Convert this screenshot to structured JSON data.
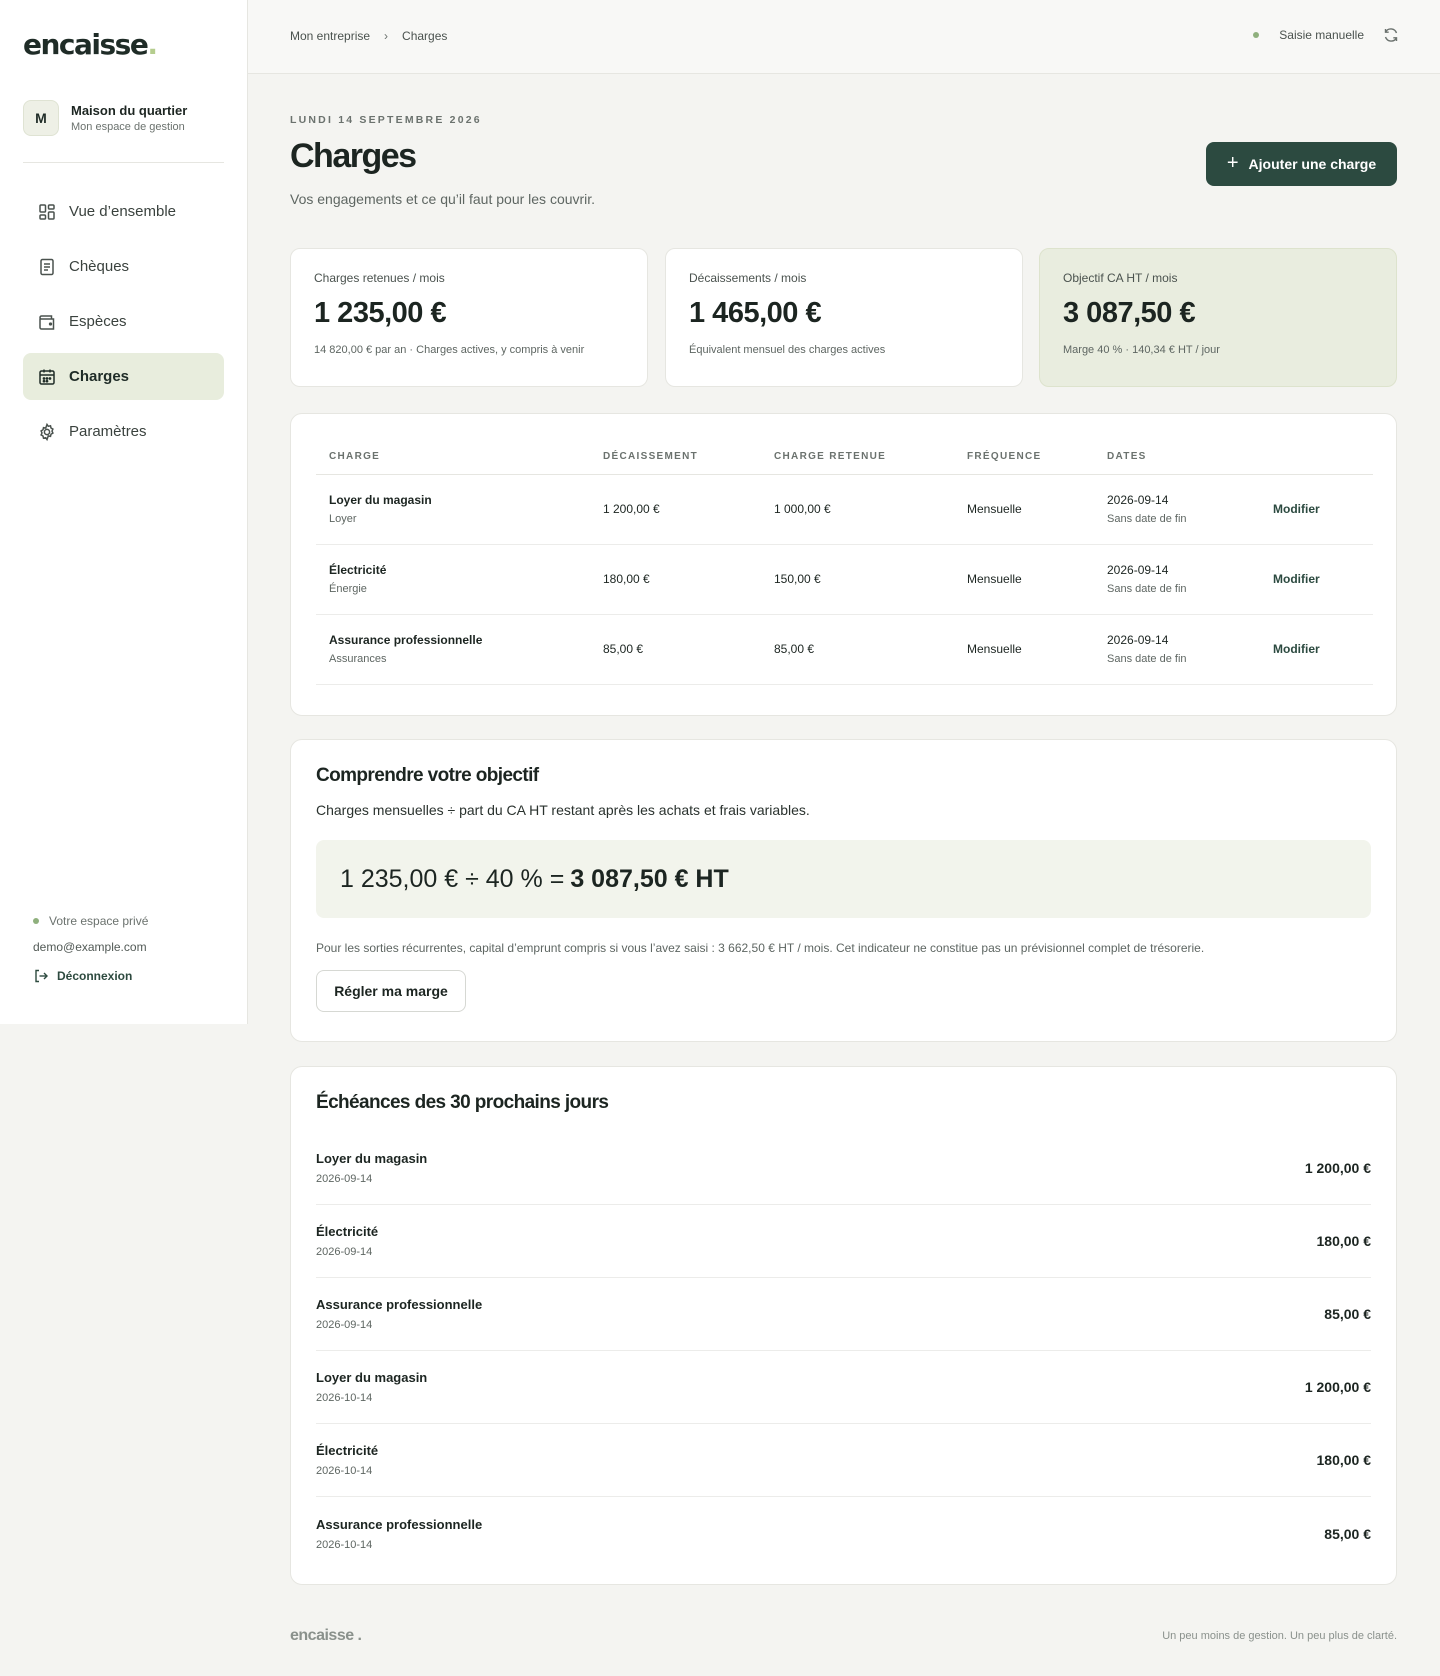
{
  "brand": {
    "logo": "encaisse",
    "logo_dot": "."
  },
  "org": {
    "initial": "M",
    "name": "Maison du quartier",
    "subtitle": "Mon espace de gestion"
  },
  "nav": {
    "items": [
      {
        "label": "Vue d’ensemble",
        "icon": "dashboard-icon"
      },
      {
        "label": "Chèques",
        "icon": "document-icon"
      },
      {
        "label": "Espèces",
        "icon": "wallet-icon"
      },
      {
        "label": "Charges",
        "icon": "calendar-icon",
        "active": true
      },
      {
        "label": "Paramètres",
        "icon": "gear-icon"
      }
    ]
  },
  "sidebar_footer": {
    "private_label": "Votre espace privé",
    "email": "demo@example.com",
    "logout_label": "Déconnexion"
  },
  "breadcrumb": {
    "root": "Mon entreprise",
    "current": "Charges"
  },
  "sync": {
    "status": "Saisie manuelle"
  },
  "header": {
    "date": "LUNDI 14 SEPTEMBRE 2026",
    "title": "Charges",
    "subtitle": "Vos engagements et ce qu’il faut pour les couvrir.",
    "add_button": "Ajouter une charge"
  },
  "cards": [
    {
      "label": "Charges retenues / mois",
      "value": "1 235,00 €",
      "note": "14 820,00 € par an · Charges actives, y compris à venir"
    },
    {
      "label": "Décaissements / mois",
      "value": "1 465,00 €",
      "note": "Équivalent mensuel des charges actives"
    },
    {
      "label": "Objectif CA HT / mois",
      "value": "3 087,50 €",
      "note": "Marge 40 % · 140,34 € HT / jour"
    }
  ],
  "table": {
    "headers": [
      "CHARGE",
      "DÉCAISSEMENT",
      "CHARGE RETENUE",
      "FRÉQUENCE",
      "DATES"
    ],
    "rows": [
      {
        "name": "Loyer du magasin",
        "category": "Loyer",
        "disbursement": "1 200,00 €",
        "retained": "1 000,00 €",
        "frequency": "Mensuelle",
        "start": "2026-09-14",
        "end": "Sans date de fin",
        "action": "Modifier"
      },
      {
        "name": "Électricité",
        "category": "Énergie",
        "disbursement": "180,00 €",
        "retained": "150,00 €",
        "frequency": "Mensuelle",
        "start": "2026-09-14",
        "end": "Sans date de fin",
        "action": "Modifier"
      },
      {
        "name": "Assurance professionnelle",
        "category": "Assurances",
        "disbursement": "85,00 €",
        "retained": "85,00 €",
        "frequency": "Mensuelle",
        "start": "2026-09-14",
        "end": "Sans date de fin",
        "action": "Modifier"
      }
    ]
  },
  "objective": {
    "title": "Comprendre votre objectif",
    "description": "Charges mensuelles ÷ part du CA HT restant après les achats et frais variables.",
    "formula": "1 235,00 € ÷ 40 % =",
    "formula_result": "3 087,50 € HT",
    "note": "Pour les sorties récurrentes, capital d’emprunt compris si vous l’avez saisi : 3 662,50 € HT / mois. Cet indicateur ne constitue pas un prévisionnel complet de trésorerie.",
    "button": "Régler ma marge"
  },
  "upcoming": {
    "title": "Échéances des 30 prochains jours",
    "items": [
      {
        "name": "Loyer du magasin",
        "date": "2026-09-14",
        "amount": "1 200,00 €"
      },
      {
        "name": "Électricité",
        "date": "2026-09-14",
        "amount": "180,00 €"
      },
      {
        "name": "Assurance professionnelle",
        "date": "2026-09-14",
        "amount": "85,00 €"
      },
      {
        "name": "Loyer du magasin",
        "date": "2026-10-14",
        "amount": "1 200,00 €"
      },
      {
        "name": "Électricité",
        "date": "2026-10-14",
        "amount": "180,00 €"
      },
      {
        "name": "Assurance professionnelle",
        "date": "2026-10-14",
        "amount": "85,00 €"
      }
    ]
  },
  "footer": {
    "logo": "encaisse .",
    "tagline": "Un peu moins de gestion. Un peu plus de clarté."
  },
  "colors": {
    "accent": "#2c4a40",
    "active_nav_bg": "#e8eddd",
    "highlight_card_bg": "#e9eddf",
    "status_dot": "#8fb07d"
  }
}
